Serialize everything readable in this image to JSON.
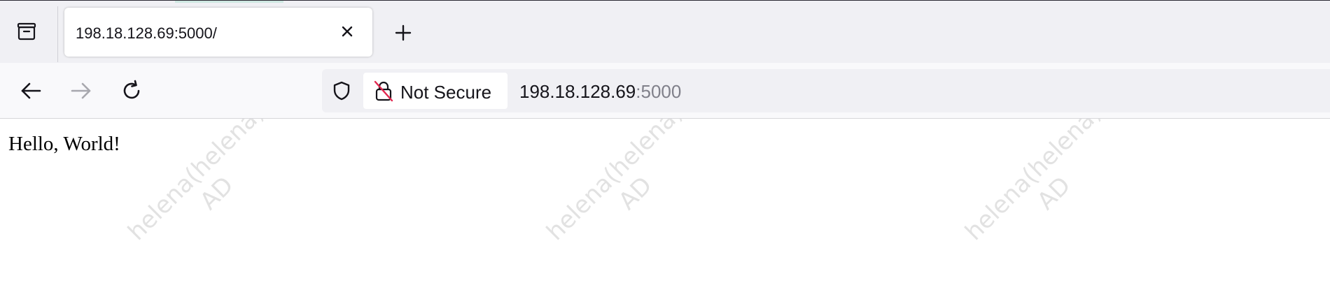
{
  "tab": {
    "title": "198.18.128.69:5000/"
  },
  "urlbar": {
    "not_secure_label": "Not Secure",
    "host": "198.18.128.69",
    "port": ":5000"
  },
  "icons": {
    "tab_manager": "tab-manager-icon",
    "tab_close": "close-icon",
    "new_tab": "plus-icon",
    "back": "arrow-left-icon",
    "forward": "arrow-right-icon",
    "reload": "reload-icon",
    "tracking_protection": "shield-icon",
    "not_secure": "lock-slash-icon"
  },
  "page": {
    "body_text": "Hello, World!"
  },
  "watermark": {
    "line1": "helena(helena)",
    "line2": "AD"
  },
  "colors": {
    "tabstrip_bg": "#f0f0f4",
    "navbar_bg": "#f9f9fb",
    "urlbar_bg": "#f0f0f4",
    "lock_warning": "#e22850",
    "port_text": "#80808a"
  }
}
